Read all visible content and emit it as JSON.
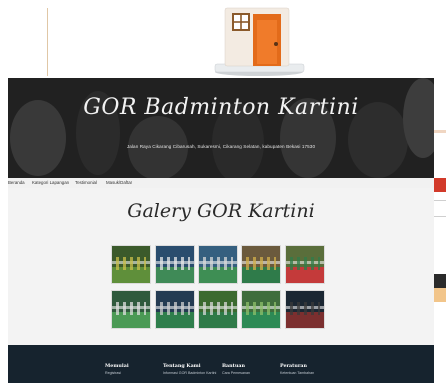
{
  "hero": {
    "title": "GOR Badminton Kartini",
    "address": "Jalan Raya Cikarang Cibarusah, Sukaresmi, Cikarang Selatan, kabupaten Bekasi 17530"
  },
  "nav": {
    "items": [
      "Beranda",
      "Kategori Lapangan",
      "Testimonial",
      "Masuk/Daftar"
    ]
  },
  "gallery": {
    "title": "Galery GOR Kartini",
    "photos": [
      {
        "name": "gallery-photo-1",
        "colors": [
          "#3b5a2b",
          "#5f8f3a",
          "#c9c04a"
        ]
      },
      {
        "name": "gallery-photo-2",
        "colors": [
          "#2a4d6e",
          "#3f8a57",
          "#e8e8e8"
        ]
      },
      {
        "name": "gallery-photo-3",
        "colors": [
          "#355f7f",
          "#3e8e54",
          "#d8d8d8"
        ]
      },
      {
        "name": "gallery-photo-4",
        "colors": [
          "#6b5a3d",
          "#2f7b4a",
          "#d3b04a"
        ]
      },
      {
        "name": "gallery-photo-5",
        "colors": [
          "#5a6e3b",
          "#c43a3a",
          "#2f7d49"
        ]
      },
      {
        "name": "gallery-photo-6",
        "colors": [
          "#2f5a3d",
          "#4b9a55",
          "#e0e0e0"
        ]
      },
      {
        "name": "gallery-photo-7",
        "colors": [
          "#243b52",
          "#2f7e4c",
          "#cfcfcf"
        ]
      },
      {
        "name": "gallery-photo-8",
        "colors": [
          "#3b6a2f",
          "#2f7a48",
          "#d9d9d9"
        ]
      },
      {
        "name": "gallery-photo-9",
        "colors": [
          "#3f6d3d",
          "#2d8a55",
          "#8ec06a"
        ]
      },
      {
        "name": "gallery-photo-10",
        "colors": [
          "#1b2733",
          "#7b2f2f",
          "#3a3a3a"
        ]
      }
    ]
  },
  "footer": {
    "columns": [
      {
        "heading": "Memulai",
        "sub": "Registrasi"
      },
      {
        "heading": "Tentang Kami",
        "sub": "Informasi GOR Badminton Kartini"
      },
      {
        "heading": "Bantuan",
        "sub": "Cara Pemesanan"
      },
      {
        "heading": "Peraturan",
        "sub": "Ketentuan Tambahan"
      }
    ]
  },
  "colors": {
    "footer_bg": "#16232e",
    "accent_red": "#d23a2a",
    "accent_orange": "#f2c58a"
  }
}
